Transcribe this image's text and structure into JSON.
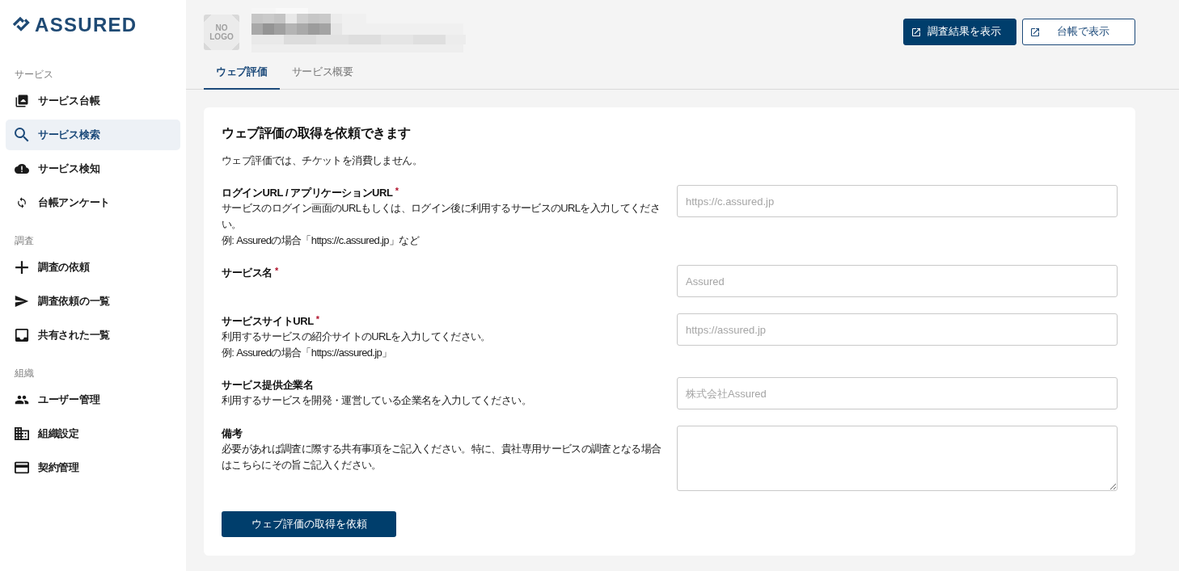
{
  "sidebar": {
    "logo": "ASSURED",
    "sections": [
      {
        "heading": "サービス",
        "items": [
          {
            "label": "サービス台帳",
            "selected": false
          },
          {
            "label": "サービス検索",
            "selected": true
          },
          {
            "label": "サービス検知",
            "selected": false
          },
          {
            "label": "台帳アンケート",
            "selected": false
          }
        ]
      },
      {
        "heading": "調査",
        "items": [
          {
            "label": "調査の依頼",
            "selected": false
          },
          {
            "label": "調査依頼の一覧",
            "selected": false
          },
          {
            "label": "共有された一覧",
            "selected": false
          }
        ]
      },
      {
        "heading": "組織",
        "items": [
          {
            "label": "ユーザー管理",
            "selected": false
          },
          {
            "label": "組織設定",
            "selected": false
          },
          {
            "label": "契約管理",
            "selected": false
          }
        ]
      }
    ]
  },
  "header": {
    "logo_placeholder": "NO LOGO",
    "buttons": [
      {
        "label": "調査結果を表示",
        "kind": "primary"
      },
      {
        "label": "台帳で表示",
        "kind": "outline"
      }
    ]
  },
  "tabs": [
    {
      "label": "ウェブ評価",
      "selected": true
    },
    {
      "label": "サービス概要",
      "selected": false
    }
  ],
  "card": {
    "title": "ウェブ評価の取得を依頼できます",
    "note": "ウェブ評価では、チケットを消費しません。",
    "fields": [
      {
        "label": "ログインURL / アプリケーションURL",
        "required_mark": "*",
        "help": [
          "サービスのログイン画面のURLもしくは、ログイン後に利用するサービスのURLを入力してください。",
          "例: Assuredの場合「https://c.assured.jp」など"
        ],
        "kind": "input",
        "placeholder": "https://c.assured.jp"
      },
      {
        "label": "サービス名",
        "required_mark": "*",
        "kind": "input",
        "placeholder": "Assured"
      },
      {
        "label": "サービスサイトURL",
        "required_mark": "*",
        "help": [
          "利用するサービスの紹介サイトのURLを入力してください。",
          "例: Assuredの場合「https://assured.jp」"
        ],
        "kind": "input",
        "placeholder": "https://assured.jp"
      },
      {
        "label": "サービス提供企業名",
        "help": [
          "利用するサービスを開発・運営している企業名を入力してください。"
        ],
        "kind": "input",
        "placeholder": "株式会社Assured"
      },
      {
        "label": "備考",
        "help": [
          "必要があれば調査に際する共有事項をご記入ください。特に、貴社専用サービスの調査となる場合はこちらにその旨ご記入ください。"
        ],
        "kind": "textarea"
      }
    ],
    "submit": "ウェブ評価の取得を依頼"
  }
}
